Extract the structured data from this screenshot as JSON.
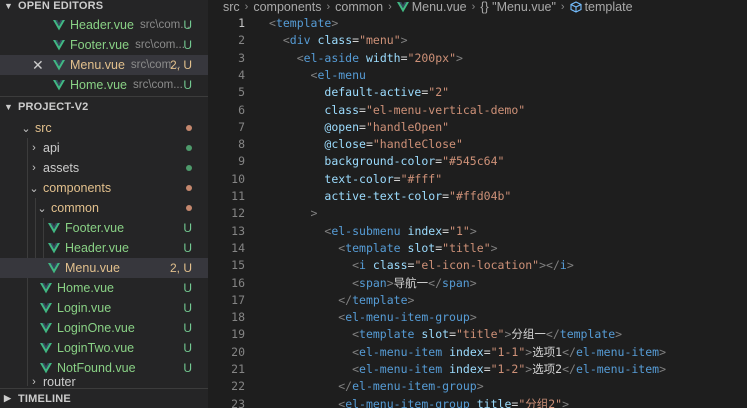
{
  "sidebar": {
    "open_editors": {
      "title": "OPEN EDITORS",
      "items": [
        {
          "name": "Header.vue",
          "path": "src\\com...",
          "status": "U"
        },
        {
          "name": "Footer.vue",
          "path": "src\\com...",
          "status": "U"
        },
        {
          "name": "Menu.vue",
          "path": "src\\com...",
          "status": "2, U",
          "close": "✕"
        },
        {
          "name": "Home.vue",
          "path": "src\\com...",
          "status": "U"
        }
      ]
    },
    "project": {
      "title": "PROJECT-V2",
      "tree": [
        {
          "name": "src"
        },
        {
          "name": "api"
        },
        {
          "name": "assets"
        },
        {
          "name": "components"
        },
        {
          "name": "common"
        },
        {
          "name": "Footer.vue",
          "status": "U"
        },
        {
          "name": "Header.vue",
          "status": "U"
        },
        {
          "name": "Menu.vue",
          "status": "2, U"
        },
        {
          "name": "Home.vue",
          "status": "U"
        },
        {
          "name": "Login.vue",
          "status": "U"
        },
        {
          "name": "LoginOne.vue",
          "status": "U"
        },
        {
          "name": "LoginTwo.vue",
          "status": "U"
        },
        {
          "name": "NotFound.vue",
          "status": "U"
        },
        {
          "name": "router"
        }
      ]
    },
    "timeline": {
      "title": "TIMELINE"
    }
  },
  "breadcrumb": {
    "parts": [
      "src",
      "components",
      "common",
      "Menu.vue",
      "{} \"Menu.vue\"",
      "template"
    ]
  },
  "colors": {
    "vue_green": "#41b883",
    "vue_dark": "#35495e",
    "untracked": "#73c991",
    "modified": "#e2c08d"
  },
  "editor": {
    "current_line": 1,
    "lines": [
      {
        "n": "1",
        "t": [
          [
            "p",
            "<"
          ],
          [
            "g",
            "template"
          ],
          [
            "p",
            ">"
          ]
        ]
      },
      {
        "n": "2",
        "t": [
          [
            "x",
            "  "
          ],
          [
            "p",
            "<"
          ],
          [
            "g",
            "div"
          ],
          [
            "x",
            " "
          ],
          [
            "a",
            "class"
          ],
          [
            "x",
            "="
          ],
          [
            "s",
            "\"menu\""
          ],
          [
            "p",
            ">"
          ]
        ]
      },
      {
        "n": "3",
        "t": [
          [
            "x",
            "    "
          ],
          [
            "p",
            "<"
          ],
          [
            "g",
            "el-aside"
          ],
          [
            "x",
            " "
          ],
          [
            "a",
            "width"
          ],
          [
            "x",
            "="
          ],
          [
            "s",
            "\"200px\""
          ],
          [
            "p",
            ">"
          ]
        ]
      },
      {
        "n": "4",
        "t": [
          [
            "x",
            "      "
          ],
          [
            "p",
            "<"
          ],
          [
            "g",
            "el-menu"
          ]
        ]
      },
      {
        "n": "5",
        "t": [
          [
            "x",
            "        "
          ],
          [
            "a",
            "default-active"
          ],
          [
            "x",
            "="
          ],
          [
            "s",
            "\"2\""
          ]
        ]
      },
      {
        "n": "6",
        "t": [
          [
            "x",
            "        "
          ],
          [
            "a",
            "class"
          ],
          [
            "x",
            "="
          ],
          [
            "s",
            "\"el-menu-vertical-demo\""
          ]
        ]
      },
      {
        "n": "7",
        "t": [
          [
            "x",
            "        "
          ],
          [
            "a",
            "@open"
          ],
          [
            "x",
            "="
          ],
          [
            "s",
            "\"handleOpen\""
          ]
        ]
      },
      {
        "n": "8",
        "t": [
          [
            "x",
            "        "
          ],
          [
            "a",
            "@close"
          ],
          [
            "x",
            "="
          ],
          [
            "s",
            "\"handleClose\""
          ]
        ]
      },
      {
        "n": "9",
        "t": [
          [
            "x",
            "        "
          ],
          [
            "a",
            "background-color"
          ],
          [
            "x",
            "="
          ],
          [
            "s",
            "\"#545c64\""
          ]
        ]
      },
      {
        "n": "10",
        "t": [
          [
            "x",
            "        "
          ],
          [
            "a",
            "text-color"
          ],
          [
            "x",
            "="
          ],
          [
            "s",
            "\"#fff\""
          ]
        ]
      },
      {
        "n": "11",
        "t": [
          [
            "x",
            "        "
          ],
          [
            "a",
            "active-text-color"
          ],
          [
            "x",
            "="
          ],
          [
            "s",
            "\"#ffd04b\""
          ]
        ]
      },
      {
        "n": "12",
        "t": [
          [
            "x",
            "      "
          ],
          [
            "p",
            ">"
          ]
        ]
      },
      {
        "n": "13",
        "t": [
          [
            "x",
            "        "
          ],
          [
            "p",
            "<"
          ],
          [
            "g",
            "el-submenu"
          ],
          [
            "x",
            " "
          ],
          [
            "a",
            "index"
          ],
          [
            "x",
            "="
          ],
          [
            "s",
            "\"1\""
          ],
          [
            "p",
            ">"
          ]
        ]
      },
      {
        "n": "14",
        "t": [
          [
            "x",
            "          "
          ],
          [
            "p",
            "<"
          ],
          [
            "g",
            "template"
          ],
          [
            "x",
            " "
          ],
          [
            "a",
            "slot"
          ],
          [
            "x",
            "="
          ],
          [
            "s",
            "\"title\""
          ],
          [
            "p",
            ">"
          ]
        ]
      },
      {
        "n": "15",
        "t": [
          [
            "x",
            "            "
          ],
          [
            "p",
            "<"
          ],
          [
            "g",
            "i"
          ],
          [
            "x",
            " "
          ],
          [
            "a",
            "class"
          ],
          [
            "x",
            "="
          ],
          [
            "s",
            "\"el-icon-location\""
          ],
          [
            "p",
            "></"
          ],
          [
            "g",
            "i"
          ],
          [
            "p",
            ">"
          ]
        ]
      },
      {
        "n": "16",
        "t": [
          [
            "x",
            "            "
          ],
          [
            "p",
            "<"
          ],
          [
            "g",
            "span"
          ],
          [
            "p",
            ">"
          ],
          [
            "x",
            "导航一"
          ],
          [
            "p",
            "</"
          ],
          [
            "g",
            "span"
          ],
          [
            "p",
            ">"
          ]
        ]
      },
      {
        "n": "17",
        "t": [
          [
            "x",
            "          "
          ],
          [
            "p",
            "</"
          ],
          [
            "g",
            "template"
          ],
          [
            "p",
            ">"
          ]
        ]
      },
      {
        "n": "18",
        "t": [
          [
            "x",
            "          "
          ],
          [
            "p",
            "<"
          ],
          [
            "g",
            "el-menu-item-group"
          ],
          [
            "p",
            ">"
          ]
        ]
      },
      {
        "n": "19",
        "t": [
          [
            "x",
            "            "
          ],
          [
            "p",
            "<"
          ],
          [
            "g",
            "template"
          ],
          [
            "x",
            " "
          ],
          [
            "a",
            "slot"
          ],
          [
            "x",
            "="
          ],
          [
            "s",
            "\"title\""
          ],
          [
            "p",
            ">"
          ],
          [
            "x",
            "分组一"
          ],
          [
            "p",
            "</"
          ],
          [
            "g",
            "template"
          ],
          [
            "p",
            ">"
          ]
        ]
      },
      {
        "n": "20",
        "t": [
          [
            "x",
            "            "
          ],
          [
            "p",
            "<"
          ],
          [
            "g",
            "el-menu-item"
          ],
          [
            "x",
            " "
          ],
          [
            "a",
            "index"
          ],
          [
            "x",
            "="
          ],
          [
            "s",
            "\"1-1\""
          ],
          [
            "p",
            ">"
          ],
          [
            "x",
            "选项1"
          ],
          [
            "p",
            "</"
          ],
          [
            "g",
            "el-menu-item"
          ],
          [
            "p",
            ">"
          ]
        ]
      },
      {
        "n": "21",
        "t": [
          [
            "x",
            "            "
          ],
          [
            "p",
            "<"
          ],
          [
            "g",
            "el-menu-item"
          ],
          [
            "x",
            " "
          ],
          [
            "a",
            "index"
          ],
          [
            "x",
            "="
          ],
          [
            "s",
            "\"1-2\""
          ],
          [
            "p",
            ">"
          ],
          [
            "x",
            "选项2"
          ],
          [
            "p",
            "</"
          ],
          [
            "g",
            "el-menu-item"
          ],
          [
            "p",
            ">"
          ]
        ]
      },
      {
        "n": "22",
        "t": [
          [
            "x",
            "          "
          ],
          [
            "p",
            "</"
          ],
          [
            "g",
            "el-menu-item-group"
          ],
          [
            "p",
            ">"
          ]
        ]
      },
      {
        "n": "23",
        "t": [
          [
            "x",
            "          "
          ],
          [
            "p",
            "<"
          ],
          [
            "g",
            "el-menu-item-group"
          ],
          [
            "x",
            " "
          ],
          [
            "a",
            "title"
          ],
          [
            "x",
            "="
          ],
          [
            "s",
            "\"分组2\""
          ],
          [
            "p",
            ">"
          ]
        ]
      }
    ]
  }
}
